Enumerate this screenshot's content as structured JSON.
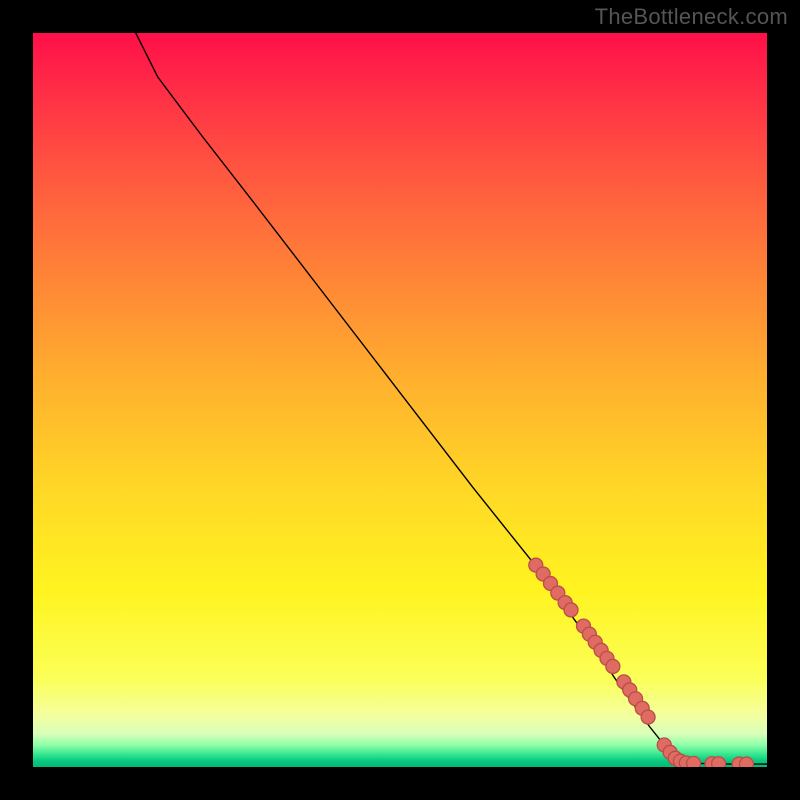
{
  "watermark": "TheBottleneck.com",
  "colors": {
    "frame_bg": "#000000",
    "curve_stroke": "#000000",
    "marker_fill": "#e06b63",
    "marker_stroke": "#b84f48"
  },
  "chart_data": {
    "type": "line",
    "title": "",
    "xlabel": "",
    "ylabel": "",
    "xlim": [
      0,
      100
    ],
    "ylim": [
      0,
      100
    ],
    "grid": false,
    "curve": [
      {
        "x": 14,
        "y": 100
      },
      {
        "x": 15,
        "y": 98
      },
      {
        "x": 17,
        "y": 94
      },
      {
        "x": 20,
        "y": 90
      },
      {
        "x": 23,
        "y": 86
      },
      {
        "x": 30,
        "y": 77
      },
      {
        "x": 40,
        "y": 64
      },
      {
        "x": 50,
        "y": 51
      },
      {
        "x": 60,
        "y": 38
      },
      {
        "x": 68,
        "y": 28
      },
      {
        "x": 76,
        "y": 17
      },
      {
        "x": 80,
        "y": 11
      },
      {
        "x": 84,
        "y": 5.5
      },
      {
        "x": 86,
        "y": 3
      },
      {
        "x": 88,
        "y": 1.2
      },
      {
        "x": 90,
        "y": 0.5
      },
      {
        "x": 95,
        "y": 0.4
      },
      {
        "x": 100,
        "y": 0.4
      }
    ],
    "markers": [
      {
        "x": 68.5,
        "y": 27.5
      },
      {
        "x": 69.5,
        "y": 26.3
      },
      {
        "x": 70.5,
        "y": 25.0
      },
      {
        "x": 71.5,
        "y": 23.7
      },
      {
        "x": 72.5,
        "y": 22.4
      },
      {
        "x": 73.3,
        "y": 21.4
      },
      {
        "x": 75.0,
        "y": 19.2
      },
      {
        "x": 75.8,
        "y": 18.1
      },
      {
        "x": 76.6,
        "y": 17.0
      },
      {
        "x": 77.4,
        "y": 15.9
      },
      {
        "x": 78.2,
        "y": 14.8
      },
      {
        "x": 79.0,
        "y": 13.7
      },
      {
        "x": 80.5,
        "y": 11.6
      },
      {
        "x": 81.3,
        "y": 10.5
      },
      {
        "x": 82.1,
        "y": 9.3
      },
      {
        "x": 83.0,
        "y": 8.0
      },
      {
        "x": 83.8,
        "y": 6.8
      },
      {
        "x": 86.0,
        "y": 3.0
      },
      {
        "x": 86.8,
        "y": 2.0
      },
      {
        "x": 87.5,
        "y": 1.2
      },
      {
        "x": 88.2,
        "y": 0.8
      },
      {
        "x": 89.0,
        "y": 0.55
      },
      {
        "x": 90.0,
        "y": 0.5
      },
      {
        "x": 92.5,
        "y": 0.45
      },
      {
        "x": 93.4,
        "y": 0.45
      },
      {
        "x": 96.2,
        "y": 0.4
      },
      {
        "x": 97.2,
        "y": 0.4
      }
    ]
  }
}
